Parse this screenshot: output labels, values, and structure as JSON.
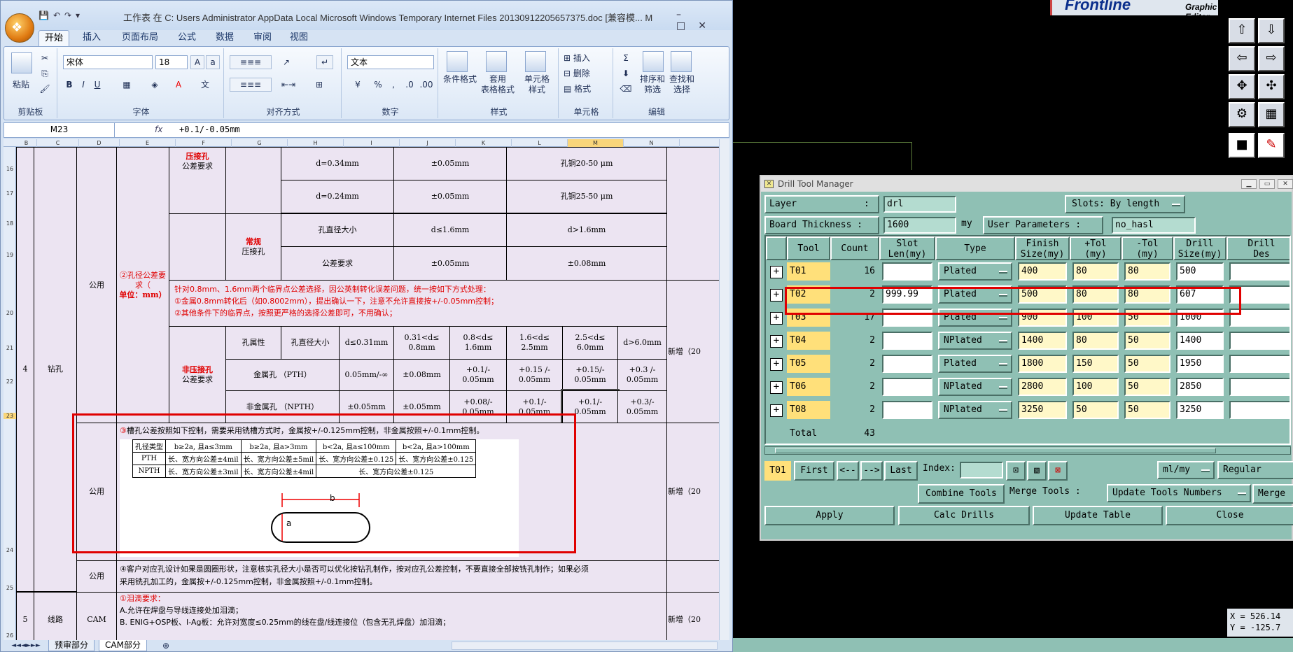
{
  "excel": {
    "caption": "工作表 在 C: Users Administrator AppData Local Microsoft Windows Temporary Internet Files 20130912205657375.doc [兼容模... M",
    "tabs": [
      "开始",
      "插入",
      "页面布局",
      "公式",
      "数据",
      "审阅",
      "视图"
    ],
    "ribbon": {
      "paste": "粘贴",
      "clipboard": "剪贴板",
      "font_name": "宋体",
      "font_size": "18",
      "font_group": "字体",
      "align_group": "对齐方式",
      "number_format": "文本",
      "number_group": "数字",
      "cond_format": "条件格式",
      "table_format": "套用\n表格格式",
      "cell_style": "单元格\n样式",
      "styles_group": "样式",
      "insert": "插入",
      "delete": "删除",
      "format": "格式",
      "cells_group": "单元格",
      "sort": "排序和\n筛选",
      "find": "查找和\n选择",
      "edit_group": "编辑"
    },
    "name_box": "M23",
    "formula": "+0.1/-0.05mm",
    "columns": [
      "B",
      "C",
      "D",
      "E",
      "F",
      "G",
      "H",
      "I",
      "J",
      "K",
      "L",
      "M",
      "N"
    ],
    "rows": [
      "16",
      "17",
      "18",
      "19",
      "20",
      "21",
      "22",
      "23",
      "24",
      "25",
      "26"
    ],
    "sheet": {
      "num4": "4",
      "drill": "钻孔",
      "public1": "公用",
      "hole_tol": "②孔径公差要求（",
      "unit": "单位：mm）",
      "press_fit": "压接孔",
      "tol_req": "公差要求",
      "d034": "d=0.34mm",
      "d024": "d=0.24mm",
      "pm005a": "±0.05mm",
      "pm005b": "±0.05mm",
      "cu2050": "孔铜20-50 μm",
      "cu2550": "孔铜25-50 μm",
      "normal": "常规",
      "press_fit2": "压接孔",
      "hole_size": "孔直径大小",
      "d_le16": "d≤1.6mm",
      "d_gt16": "d>1.6mm",
      "tol_req2": "公差要求",
      "pm005c": "±0.05mm",
      "pm008": "±0.08mm",
      "note1": "针对0.8mm、1.6mm两个临界点公差选择，因公英制转化误差问题，统一按如下方式处理：",
      "note2": "①金属0.8mm转化后（如0.8002mm），提出确认一下，注意不允许直接按+/-0.05mm控制；",
      "note3": "②其他条件下的临界点，按照更严格的选择公差即可，不用确认；",
      "new1": "新增（20",
      "non_press": "非压接孔",
      "tol_req3": "公差要求",
      "hole_prop": "孔属性",
      "hole_size2": "孔直径大小",
      "c1": "d≤0.31mm",
      "c2": "0.31<d≤ 0.8mm",
      "c3": "0.8<d≤ 1.6mm",
      "c4": "1.6<d≤ 2.5mm",
      "c5": "2.5<d≤ 6.0mm",
      "c6": "d>6.0mm",
      "pth": "金属孔 （PTH）",
      "p1": "0.05mm/-∞",
      "p2": "±0.08mm",
      "p3": "+0.1/- 0.05mm",
      "p4": "+0.15 /- 0.05mm",
      "p5": "+0.15/- 0.05mm",
      "p6": "+0.3 /- 0.05mm",
      "npth": "非金属孔 （NPTH）",
      "n1": "±0.05mm",
      "n2": "±0.05mm",
      "n3": "+0.08/- 0.05mm",
      "n4": "+0.1/- 0.05mm",
      "n5": "+0.1/- 0.05mm",
      "n6": "+0.3/- 0.05mm",
      "public2": "公用",
      "slot_prefix": "③",
      "slot_note": "槽孔公差按照如下控制，需要采用铣槽方式时，金属按+/-0.125mm控制，非金属按照+/-0.1mm控制。",
      "new2": "新增（20",
      "sub_header": [
        "孔径类型",
        "b≥2a, 且a≤3mm",
        "b≥2a, 且a>3mm",
        "b<2a, 且a≤100mm",
        "b<2a, 且a>100mm"
      ],
      "sub_pth": [
        "PTH",
        "长、宽方向公差±4mil",
        "长、宽方向公差±5mil",
        "长、宽方向公差±0.125",
        "长、宽方向公差±0.125"
      ],
      "sub_npth": [
        "NPTH",
        "长、宽方向公差±3mil",
        "长、宽方向公差±4mil",
        "长、宽方向公差±0.125"
      ],
      "dim_b": "b",
      "dim_a": "a",
      "public3": "公用",
      "note4": "④客户对应孔设计如果是圆圈形状，注意核实孔径大小是否可以优化按钻孔制作，按对应孔公差控制，不要直接全部按铣孔制作；如果必须",
      "note5": "采用铣孔加工的，金属按+/-0.125mm控制，非金属按照+/-0.1mm控制。",
      "num5": "5",
      "line": "线路",
      "cam": "CAM",
      "teardrop": "①泪滴要求：",
      "tdA": "A.允许在焊盘与导线连接处加泪滴；",
      "tdB": "B. ENIG+OSP板、I-Ag板：允许对宽度≤0.25mm的线在盘/线连接位（包含无孔焊盘）加泪滴；",
      "new3": "新增（20"
    },
    "sheet_tabs": [
      "预审部分",
      "CAM部分"
    ]
  },
  "genesis": {
    "brand": "Frontline",
    "subtitle": "Graphic Editor",
    "coord_x": "X = 526.14",
    "coord_y": "Y = -125.7"
  },
  "dtm": {
    "title": "Drill Tool Manager",
    "layer_label": "Layer",
    "layer_colon": ":",
    "layer_value": "drl",
    "slots_label": "Slots:",
    "slots_value": "By length",
    "board_label": "Board Thickness :",
    "board_value": "1600",
    "board_unit": "my",
    "user_label": "User Parameters :",
    "user_value": "no_hasl",
    "headers": [
      "Tool",
      "Count",
      "Slot\nLen(my)",
      "Type",
      "Finish\nSize(my)",
      "+Tol\n(my)",
      "-Tol\n(my)",
      "Drill\nSize(my)",
      "Drill\nDes"
    ],
    "rows": [
      {
        "tool": "T01",
        "count": "16",
        "slot": "",
        "type": "Plated",
        "finish": "400",
        "ptol": "80",
        "ntol": "80",
        "drill": "500"
      },
      {
        "tool": "T02",
        "count": "2",
        "slot": "999.99",
        "type": "Plated",
        "finish": "500",
        "ptol": "80",
        "ntol": "80",
        "drill": "607"
      },
      {
        "tool": "T03",
        "count": "17",
        "slot": "",
        "type": "Plated",
        "finish": "900",
        "ptol": "100",
        "ntol": "50",
        "drill": "1000"
      },
      {
        "tool": "T04",
        "count": "2",
        "slot": "",
        "type": "NPlated",
        "finish": "1400",
        "ptol": "80",
        "ntol": "50",
        "drill": "1400"
      },
      {
        "tool": "T05",
        "count": "2",
        "slot": "",
        "type": "Plated",
        "finish": "1800",
        "ptol": "150",
        "ntol": "50",
        "drill": "1950"
      },
      {
        "tool": "T06",
        "count": "2",
        "slot": "",
        "type": "NPlated",
        "finish": "2800",
        "ptol": "100",
        "ntol": "50",
        "drill": "2850"
      },
      {
        "tool": "T08",
        "count": "2",
        "slot": "",
        "type": "NPlated",
        "finish": "3250",
        "ptol": "50",
        "ntol": "50",
        "drill": "3250"
      }
    ],
    "total_label": "Total",
    "total_value": "43",
    "nav_tool": "T01",
    "first": "First",
    "prev": "<--",
    "next": "-->",
    "last": "Last",
    "index_label": "Index:",
    "unit_value": "ml/my",
    "regular": "Regular",
    "combine": "Combine Tools",
    "merge_label": "Merge Tools :",
    "update_numbers": "Update Tools Numbers",
    "merge2": "Merge",
    "apply": "Apply",
    "calc": "Calc Drills",
    "update_table": "Update Table",
    "close": "Close"
  }
}
